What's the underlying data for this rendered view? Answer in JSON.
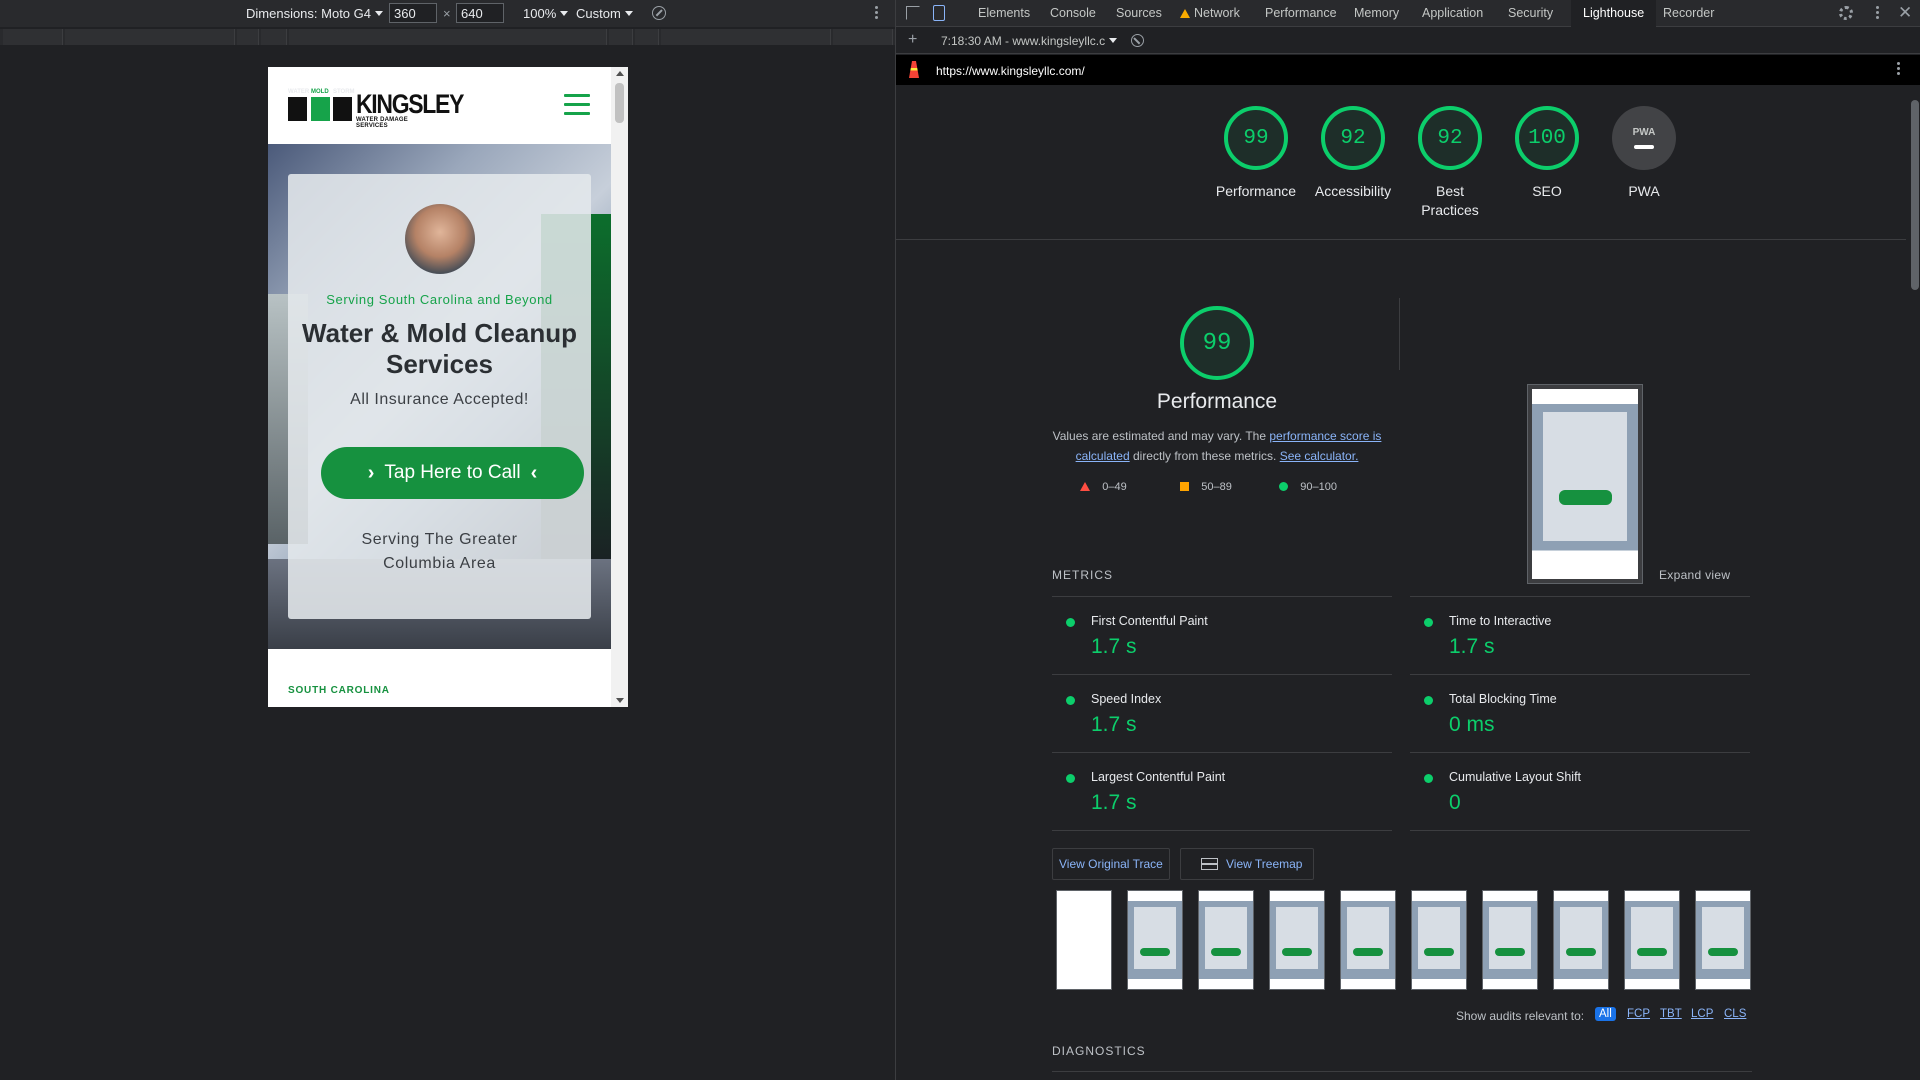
{
  "device_toolbar": {
    "dimensions_label": "Dimensions: Moto G4",
    "width_value": "360",
    "x_separator": "×",
    "height_value": "640",
    "zoom": "100%",
    "throttle": "Custom"
  },
  "site": {
    "logo_small_words": [
      "WATER",
      "MOLD",
      "STORM"
    ],
    "logo_brand": "KINGSLEY",
    "logo_tagline": "WATER DAMAGE SERVICES",
    "serving_top": "Serving South Carolina and Beyond",
    "hero_title": "Water & Mold Cleanup Services",
    "hero_subtitle": "All Insurance Accepted!",
    "call_button": "Tap Here to Call",
    "serving_bottom_line1": "Serving The Greater",
    "serving_bottom_line2": "Columbia Area",
    "footer_heading": "SOUTH CAROLINA",
    "brand_green": "#16913f"
  },
  "devtools": {
    "tabs": [
      "Elements",
      "Console",
      "Sources",
      "Network",
      "Performance",
      "Memory",
      "Application",
      "Security",
      "Lighthouse",
      "Recorder"
    ],
    "active_tab": "Lighthouse",
    "report_select": "7:18:30 AM - www.kingsleyllc.c",
    "url": "https://www.kingsleyllc.com/"
  },
  "lighthouse": {
    "categories": [
      {
        "score": "99",
        "label": "Performance"
      },
      {
        "score": "92",
        "label": "Accessibility"
      },
      {
        "score": "92",
        "label": "Best Practices"
      },
      {
        "score": "100",
        "label": "SEO"
      },
      {
        "score": "PWA",
        "label": "PWA"
      }
    ],
    "performance_score": "99",
    "performance_title": "Performance",
    "desc_prefix": "Values are estimated and may vary. The ",
    "desc_link1": "performance score is calculated",
    "desc_middle": " directly from these metrics. ",
    "desc_link2": "See calculator.",
    "legend": [
      "0–49",
      "50–89",
      "90–100"
    ],
    "metrics_heading": "METRICS",
    "expand_view": "Expand view",
    "metrics": [
      {
        "name": "First Contentful Paint",
        "value": "1.7 s"
      },
      {
        "name": "Time to Interactive",
        "value": "1.7 s"
      },
      {
        "name": "Speed Index",
        "value": "1.7 s"
      },
      {
        "name": "Total Blocking Time",
        "value": "0 ms"
      },
      {
        "name": "Largest Contentful Paint",
        "value": "1.7 s"
      },
      {
        "name": "Cumulative Layout Shift",
        "value": "0"
      }
    ],
    "view_trace": "View Original Trace",
    "view_treemap": "View Treemap",
    "show_audits_label": "Show audits relevant to:",
    "audit_filters": [
      "All",
      "FCP",
      "TBT",
      "LCP",
      "CLS"
    ],
    "diagnostics_heading": "DIAGNOSTICS",
    "pass_color": "#0cce6b"
  }
}
